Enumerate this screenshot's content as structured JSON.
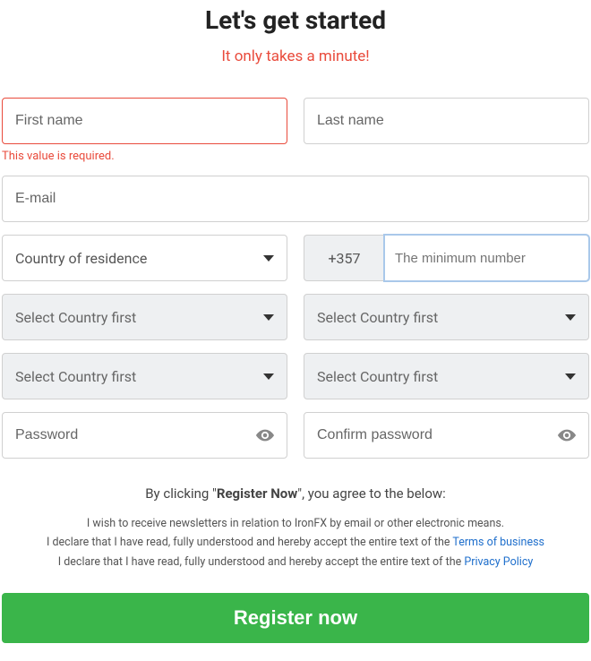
{
  "heading": "Let's get started",
  "subheading": "It only takes a minute!",
  "fields": {
    "first_name": {
      "placeholder": "First name",
      "value": "",
      "error": "This value is required."
    },
    "last_name": {
      "placeholder": "Last name",
      "value": ""
    },
    "email": {
      "placeholder": "E-mail",
      "value": ""
    },
    "country": {
      "label": "Country of residence"
    },
    "phone_code": "+357",
    "phone": {
      "placeholder": "The minimum number",
      "value": ""
    },
    "select1": {
      "label": "Select Country first"
    },
    "select2": {
      "label": "Select Country first"
    },
    "select3": {
      "label": "Select Country first"
    },
    "select4": {
      "label": "Select Country first"
    },
    "password": {
      "placeholder": "Password",
      "value": ""
    },
    "confirm_password": {
      "placeholder": "Confirm password",
      "value": ""
    }
  },
  "terms": {
    "pre": "By clicking \"",
    "bold": "Register Now",
    "post": "\", you agree to the below:",
    "line1": "I wish to receive newsletters in relation to IronFX by email or other electronic means.",
    "line2_pre": "I declare that I have read, fully understood and hereby accept the entire text of the ",
    "line2_link": "Terms of business",
    "line3_pre": "I declare that I have read, fully understood and hereby accept the entire text of the ",
    "line3_link": "Privacy Policy"
  },
  "submit_label": "Register now"
}
